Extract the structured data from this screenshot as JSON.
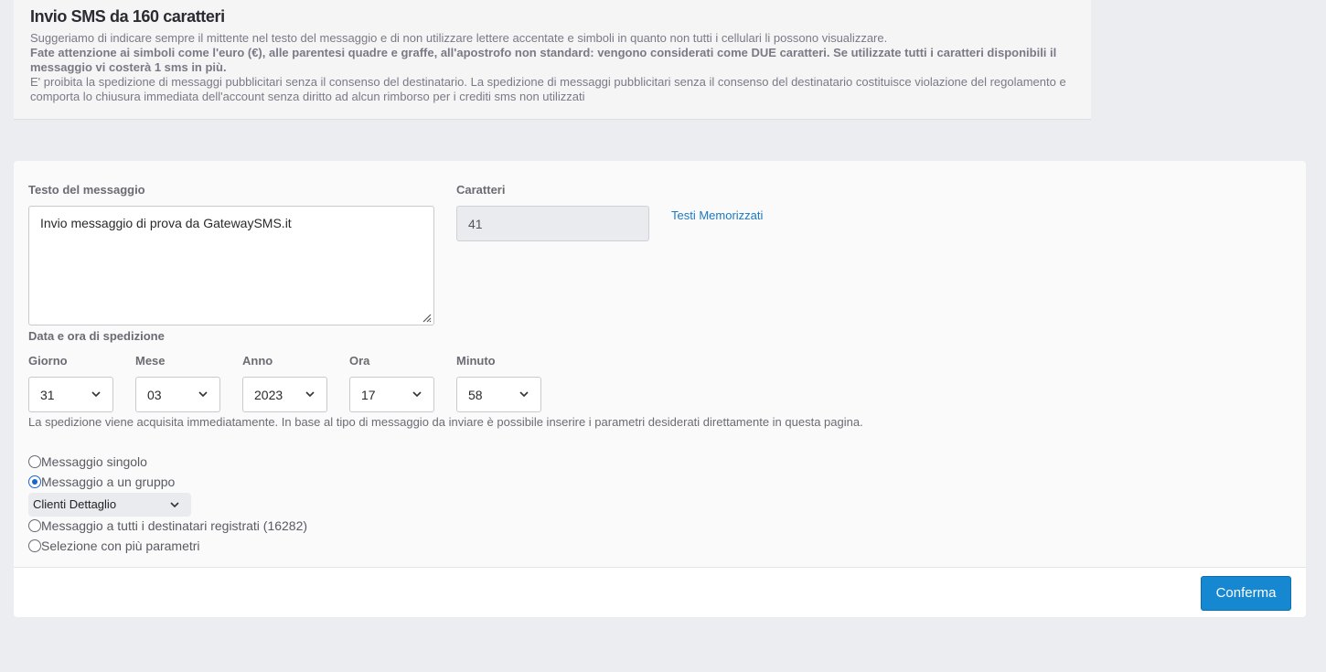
{
  "info": {
    "title": "Invio SMS da 160 caratteri",
    "line1": "Suggeriamo di indicare sempre il mittente nel testo del messaggio e di non utilizzare lettere accentate e simboli in quanto non tutti i cellulari li possono visualizzare.",
    "line2": "Fate attenzione ai simboli come l'euro (€), alle parentesi quadre e graffe, all'apostrofo non standard: vengono considerati come DUE caratteri. Se utilizzate tutti i caratteri disponibili il messaggio vi costerà 1 sms in più.",
    "line3": "E' proibita la spedizione di messaggi pubblicitari senza il consenso del destinatario. La spedizione di messaggi pubblicitari senza il consenso del destinatario costituisce violazione del regolamento e comporta lo chiusura immediata dell'account senza diritto ad alcun rimborso per i crediti sms non utilizzati"
  },
  "form": {
    "message_label": "Testo del messaggio",
    "message_value": "Invio messaggio di prova da GatewaySMS.it",
    "chars_label": "Caratteri",
    "chars_value": "41",
    "saved_texts_link": "Testi Memorizzati",
    "datetime_label": "Data e ora di spedizione",
    "day_label": "Giorno",
    "day_value": "31",
    "month_label": "Mese",
    "month_value": "03",
    "year_label": "Anno",
    "year_value": "2023",
    "hour_label": "Ora",
    "hour_value": "17",
    "minute_label": "Minuto",
    "minute_value": "58",
    "note": "La spedizione viene acquisita immediatamente. In base al tipo di messaggio da inviare è possibile inserire i parametri desiderati direttamente in questa pagina.",
    "radio_single": "Messaggio singolo",
    "radio_group": "Messaggio a un gruppo",
    "group_value": "Clienti Dettaglio",
    "radio_all": "Messaggio a tutti i destinatari registrati (16282)",
    "radio_params": "Selezione con più parametri",
    "selected_option": "radio_group"
  },
  "footer": {
    "confirm_label": "Conferma"
  },
  "colors": {
    "accent": "#1588d1",
    "link": "#1b79c4",
    "radio_active": "#1a66c9"
  },
  "icons": {
    "select_arrow": "chevron-down-icon",
    "textarea_handle": "resize-handle-icon"
  }
}
